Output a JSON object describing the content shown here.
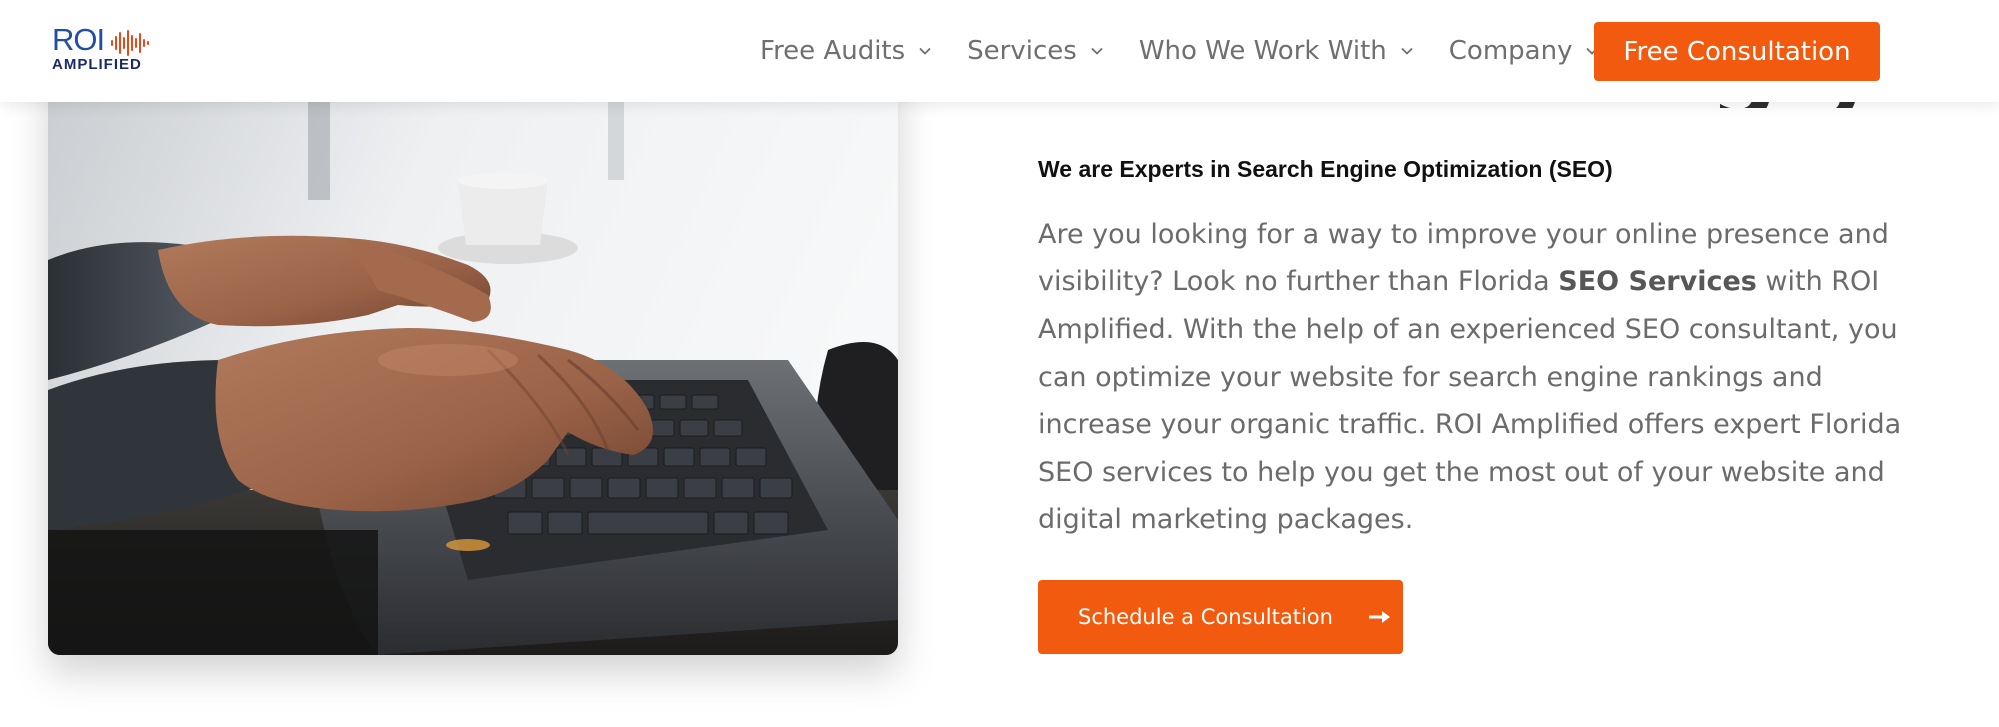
{
  "header": {
    "logo": {
      "line1": "ROI",
      "line2": "AMPLIFIED"
    },
    "nav": [
      {
        "label": "Free Audits",
        "icon": "chevron-down-icon"
      },
      {
        "label": "Services",
        "icon": "chevron-down-icon"
      },
      {
        "label": "Who We Work With",
        "icon": "chevron-down-icon"
      },
      {
        "label": "Company",
        "icon": "chevron-down-icon"
      }
    ],
    "cta_label": "Free Consultation"
  },
  "hero": {
    "background_heading_fragment": "g y",
    "kicker": "We are Experts in Search Engine Optimization (SEO)",
    "paragraph": {
      "before_bold": "Are you looking for a way to improve your online presence and visibility? Look no further than Florida ",
      "bold": "SEO Services",
      "after_bold": " with ROI Amplified. With the help of an experienced SEO consultant, you can optimize your website for search engine rankings and increase your organic traffic. ROI Amplified offers expert Florida SEO services to help you get the most out of your website and digital marketing packages."
    },
    "cta_label": "Schedule a Consultation",
    "cta_icon": "arrow-right-icon",
    "image_subject": "hands-typing-on-laptop-photo"
  },
  "colors": {
    "accent": "#f15a0f",
    "brand_blue": "#1f4fa3",
    "brand_navy": "#1b2a6b",
    "text_body": "#6b6b6b",
    "text_heading": "#111111"
  }
}
